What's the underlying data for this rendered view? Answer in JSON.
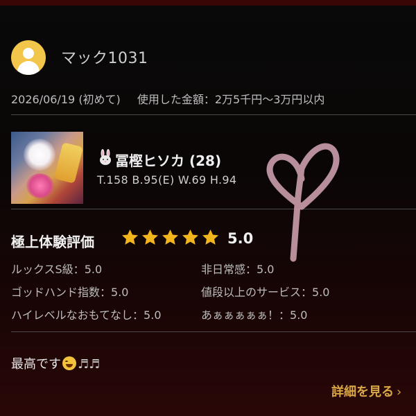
{
  "review": {
    "username": "マック1031",
    "date": "2026/06/19",
    "visit_type": "(初めて)",
    "amount_label": "使用した金額：",
    "amount_value": "2万5千円〜3万円以内"
  },
  "girl": {
    "name": "冨樫ヒソカ",
    "age": "(28)",
    "measurements": "T.158 B.95(E) W.69 H.94",
    "icon": "rabbit-icon"
  },
  "rating": {
    "title": "極上体験評価",
    "stars": 5,
    "max_stars": 5,
    "score": "5.0",
    "star_color": "#f2b51c"
  },
  "criteria": [
    {
      "label": "ルックスS級：",
      "value": "5.0"
    },
    {
      "label": "非日常感：",
      "value": "5.0"
    },
    {
      "label": "ゴッドハンド指数：",
      "value": "5.0"
    },
    {
      "label": "値段以上のサービス：",
      "value": "5.0"
    },
    {
      "label": "ハイレベルなおもてなし：",
      "value": "5.0"
    },
    {
      "label": "あぁぁぁぁぁ！：",
      "value": "5.0"
    }
  ],
  "comment": {
    "text": "最高です",
    "emoji": "grinning-squint-face",
    "notes": "♬♬"
  },
  "more_link": {
    "label": "詳細を見る",
    "chevron": "›",
    "color": "#d9a645"
  }
}
